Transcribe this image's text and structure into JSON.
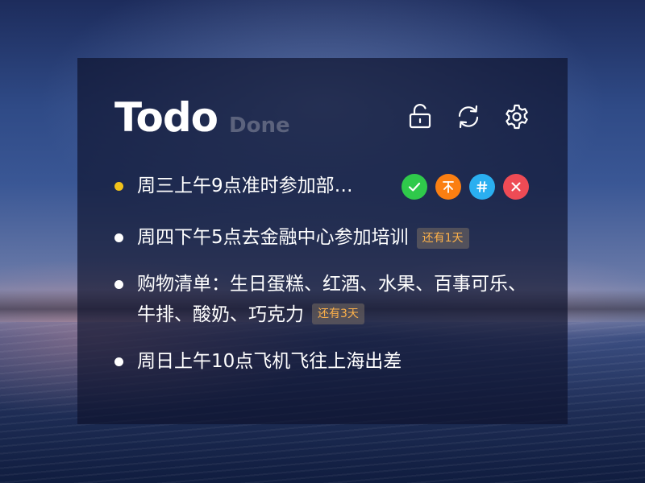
{
  "app": {
    "title": "Todo",
    "subtitle": "Done"
  },
  "header_icons": {
    "lock": "unlock-icon",
    "sync": "refresh-icon",
    "settings": "gear-icon"
  },
  "todos": [
    {
      "text": "周三上午9点准时参加部…",
      "active": true,
      "actions": [
        "check-icon",
        "pin-top-icon",
        "tag-hash-icon",
        "close-icon"
      ]
    },
    {
      "text": "周四下午5点去金融中心参加培训",
      "badge": "还有1天"
    },
    {
      "text": "购物清单：生日蛋糕、红酒、水果、百事可乐、牛排、酸奶、巧克力",
      "badge": "还有3天"
    },
    {
      "text": "周日上午10点飞机飞往上海出差"
    }
  ],
  "colors": {
    "bullet_active": "#f1c21b",
    "badge_text": "#ffb24a",
    "action_done": "#2fc94b",
    "action_top": "#fb7f12",
    "action_tag": "#2aaff0",
    "action_delete": "#ee4b55"
  }
}
